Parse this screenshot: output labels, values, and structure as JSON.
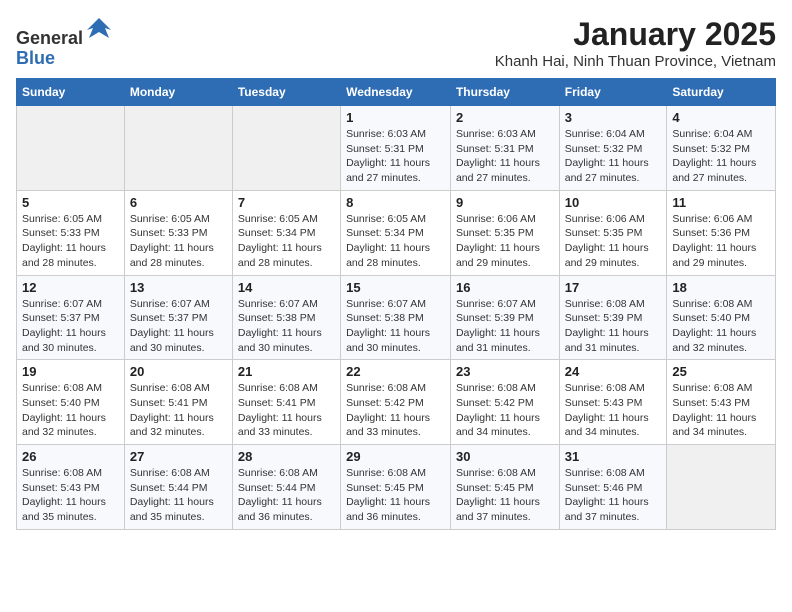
{
  "header": {
    "logo_line1": "General",
    "logo_line2": "Blue",
    "title": "January 2025",
    "subtitle": "Khanh Hai, Ninh Thuan Province, Vietnam"
  },
  "weekdays": [
    "Sunday",
    "Monday",
    "Tuesday",
    "Wednesday",
    "Thursday",
    "Friday",
    "Saturday"
  ],
  "weeks": [
    [
      {
        "day": "",
        "detail": ""
      },
      {
        "day": "",
        "detail": ""
      },
      {
        "day": "",
        "detail": ""
      },
      {
        "day": "1",
        "detail": "Sunrise: 6:03 AM\nSunset: 5:31 PM\nDaylight: 11 hours\nand 27 minutes."
      },
      {
        "day": "2",
        "detail": "Sunrise: 6:03 AM\nSunset: 5:31 PM\nDaylight: 11 hours\nand 27 minutes."
      },
      {
        "day": "3",
        "detail": "Sunrise: 6:04 AM\nSunset: 5:32 PM\nDaylight: 11 hours\nand 27 minutes."
      },
      {
        "day": "4",
        "detail": "Sunrise: 6:04 AM\nSunset: 5:32 PM\nDaylight: 11 hours\nand 27 minutes."
      }
    ],
    [
      {
        "day": "5",
        "detail": "Sunrise: 6:05 AM\nSunset: 5:33 PM\nDaylight: 11 hours\nand 28 minutes."
      },
      {
        "day": "6",
        "detail": "Sunrise: 6:05 AM\nSunset: 5:33 PM\nDaylight: 11 hours\nand 28 minutes."
      },
      {
        "day": "7",
        "detail": "Sunrise: 6:05 AM\nSunset: 5:34 PM\nDaylight: 11 hours\nand 28 minutes."
      },
      {
        "day": "8",
        "detail": "Sunrise: 6:05 AM\nSunset: 5:34 PM\nDaylight: 11 hours\nand 28 minutes."
      },
      {
        "day": "9",
        "detail": "Sunrise: 6:06 AM\nSunset: 5:35 PM\nDaylight: 11 hours\nand 29 minutes."
      },
      {
        "day": "10",
        "detail": "Sunrise: 6:06 AM\nSunset: 5:35 PM\nDaylight: 11 hours\nand 29 minutes."
      },
      {
        "day": "11",
        "detail": "Sunrise: 6:06 AM\nSunset: 5:36 PM\nDaylight: 11 hours\nand 29 minutes."
      }
    ],
    [
      {
        "day": "12",
        "detail": "Sunrise: 6:07 AM\nSunset: 5:37 PM\nDaylight: 11 hours\nand 30 minutes."
      },
      {
        "day": "13",
        "detail": "Sunrise: 6:07 AM\nSunset: 5:37 PM\nDaylight: 11 hours\nand 30 minutes."
      },
      {
        "day": "14",
        "detail": "Sunrise: 6:07 AM\nSunset: 5:38 PM\nDaylight: 11 hours\nand 30 minutes."
      },
      {
        "day": "15",
        "detail": "Sunrise: 6:07 AM\nSunset: 5:38 PM\nDaylight: 11 hours\nand 30 minutes."
      },
      {
        "day": "16",
        "detail": "Sunrise: 6:07 AM\nSunset: 5:39 PM\nDaylight: 11 hours\nand 31 minutes."
      },
      {
        "day": "17",
        "detail": "Sunrise: 6:08 AM\nSunset: 5:39 PM\nDaylight: 11 hours\nand 31 minutes."
      },
      {
        "day": "18",
        "detail": "Sunrise: 6:08 AM\nSunset: 5:40 PM\nDaylight: 11 hours\nand 32 minutes."
      }
    ],
    [
      {
        "day": "19",
        "detail": "Sunrise: 6:08 AM\nSunset: 5:40 PM\nDaylight: 11 hours\nand 32 minutes."
      },
      {
        "day": "20",
        "detail": "Sunrise: 6:08 AM\nSunset: 5:41 PM\nDaylight: 11 hours\nand 32 minutes."
      },
      {
        "day": "21",
        "detail": "Sunrise: 6:08 AM\nSunset: 5:41 PM\nDaylight: 11 hours\nand 33 minutes."
      },
      {
        "day": "22",
        "detail": "Sunrise: 6:08 AM\nSunset: 5:42 PM\nDaylight: 11 hours\nand 33 minutes."
      },
      {
        "day": "23",
        "detail": "Sunrise: 6:08 AM\nSunset: 5:42 PM\nDaylight: 11 hours\nand 34 minutes."
      },
      {
        "day": "24",
        "detail": "Sunrise: 6:08 AM\nSunset: 5:43 PM\nDaylight: 11 hours\nand 34 minutes."
      },
      {
        "day": "25",
        "detail": "Sunrise: 6:08 AM\nSunset: 5:43 PM\nDaylight: 11 hours\nand 34 minutes."
      }
    ],
    [
      {
        "day": "26",
        "detail": "Sunrise: 6:08 AM\nSunset: 5:43 PM\nDaylight: 11 hours\nand 35 minutes."
      },
      {
        "day": "27",
        "detail": "Sunrise: 6:08 AM\nSunset: 5:44 PM\nDaylight: 11 hours\nand 35 minutes."
      },
      {
        "day": "28",
        "detail": "Sunrise: 6:08 AM\nSunset: 5:44 PM\nDaylight: 11 hours\nand 36 minutes."
      },
      {
        "day": "29",
        "detail": "Sunrise: 6:08 AM\nSunset: 5:45 PM\nDaylight: 11 hours\nand 36 minutes."
      },
      {
        "day": "30",
        "detail": "Sunrise: 6:08 AM\nSunset: 5:45 PM\nDaylight: 11 hours\nand 37 minutes."
      },
      {
        "day": "31",
        "detail": "Sunrise: 6:08 AM\nSunset: 5:46 PM\nDaylight: 11 hours\nand 37 minutes."
      },
      {
        "day": "",
        "detail": ""
      }
    ]
  ]
}
